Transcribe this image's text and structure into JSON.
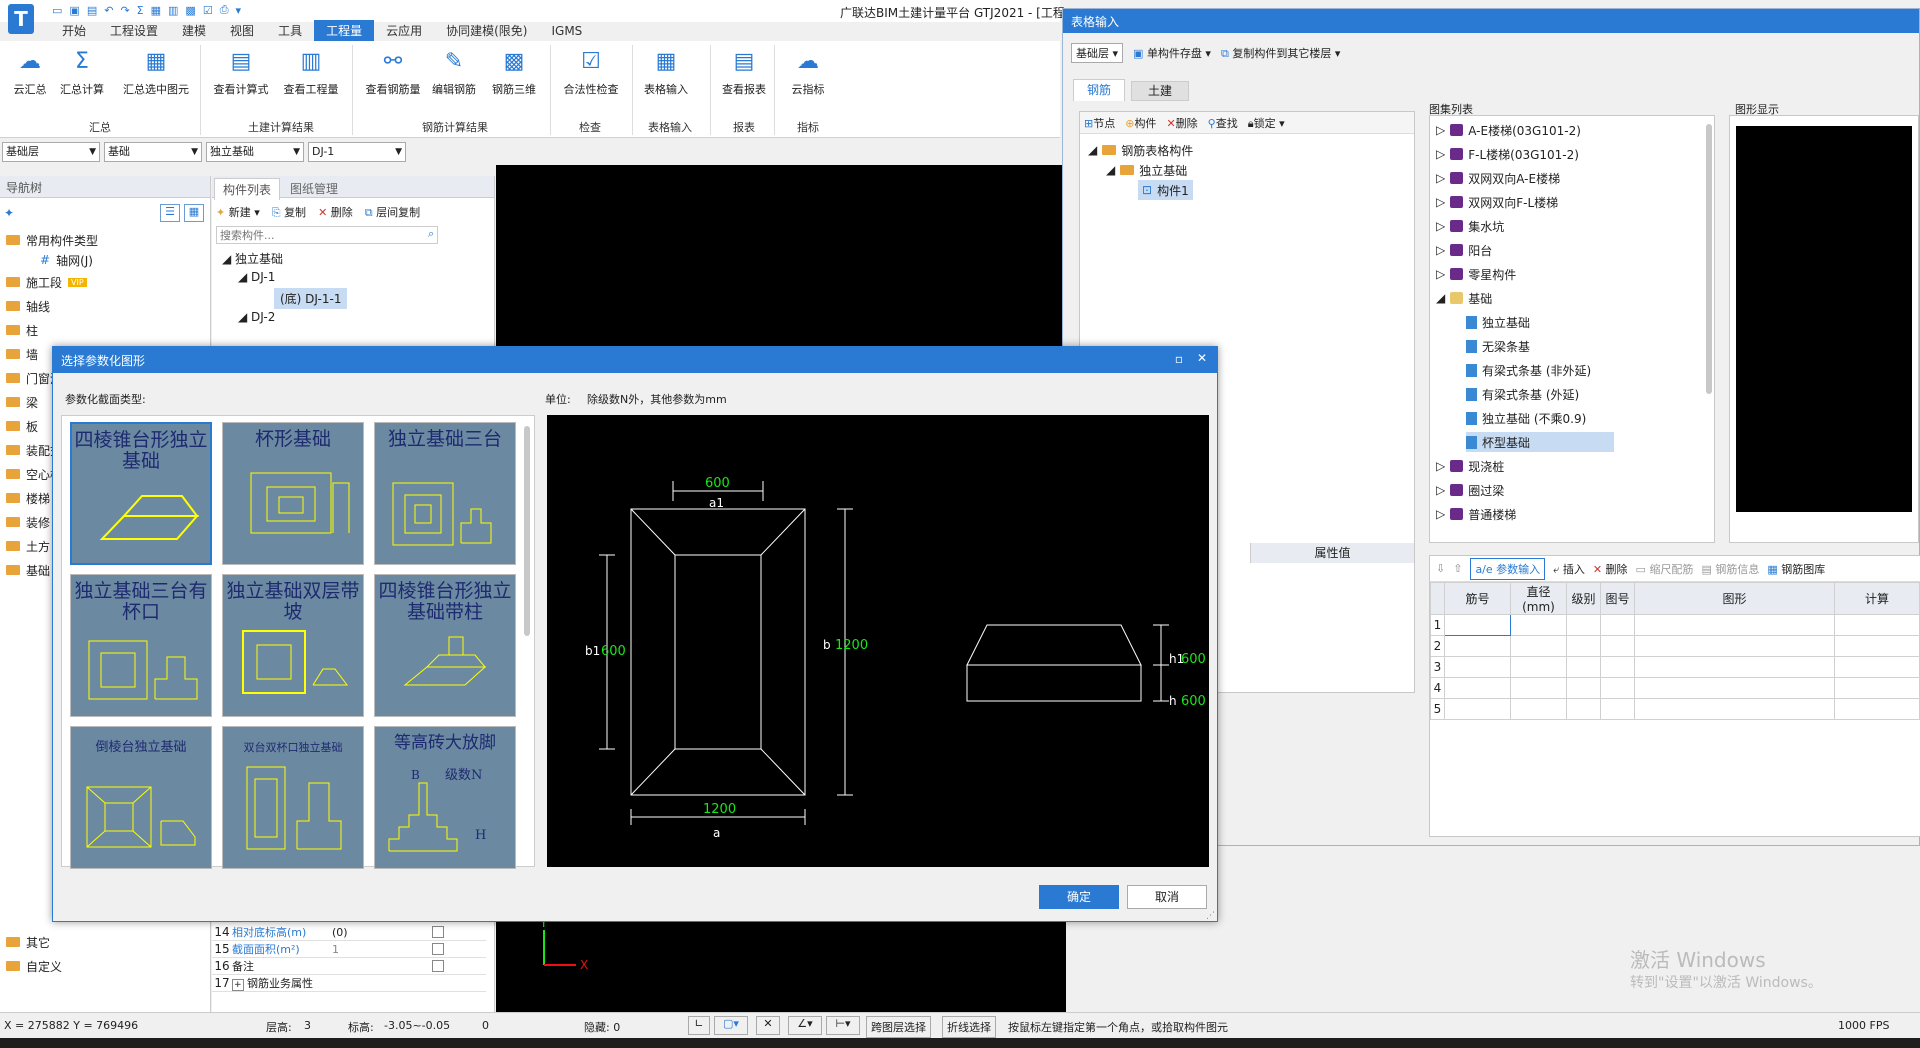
{
  "app": {
    "title": "广联达BIM土建计量平台 GTJ2021 - [工程1",
    "tabs": [
      "开始",
      "工程设置",
      "建模",
      "视图",
      "工具",
      "工程量",
      "云应用",
      "协同建模(限免)",
      "IGMS"
    ],
    "active_tab": "工程量"
  },
  "ribbon": {
    "buttons": [
      "云汇总",
      "汇总计算",
      "汇总选中图元",
      "查看计算式",
      "查看工程量",
      "查看钢筋量",
      "编辑钢筋",
      "钢筋三维",
      "合法性检查",
      "表格输入",
      "查看报表",
      "云指标"
    ],
    "groups": [
      "汇总",
      "土建计算结果",
      "钢筋计算结果",
      "检查",
      "表格输入",
      "报表",
      "指标"
    ]
  },
  "filters": [
    "基础层",
    "基础",
    "独立基础",
    "DJ-1"
  ],
  "navtree": {
    "header": "导航树",
    "items": [
      "常用构件类型",
      "轴网(J)",
      "施工段",
      "轴线",
      "柱",
      "墙",
      "门窗洞",
      "梁",
      "板",
      "装配式",
      "空心楼盖",
      "楼梯",
      "装修",
      "土方",
      "基础",
      "其它",
      "自定义"
    ],
    "vip": "VIP"
  },
  "complist": {
    "tabs": [
      "构件列表",
      "图纸管理"
    ],
    "toolbar": [
      "新建",
      "复制",
      "删除",
      "层间复制"
    ],
    "search_placeholder": "搜索构件...",
    "tree": [
      "独立基础",
      "DJ-1",
      "(底) DJ-1-1",
      "DJ-2"
    ],
    "props": [
      {
        "no": "14",
        "name": "相对底标高(m)",
        "val": "(0)"
      },
      {
        "no": "15",
        "name": "截面面积(m²)",
        "val": "1"
      },
      {
        "no": "16",
        "name": "备注",
        "val": ""
      },
      {
        "no": "17",
        "name": "钢筋业务属性",
        "val": ""
      }
    ]
  },
  "status": {
    "coords": "X = 275882 Y = 769496",
    "floor_label": "层高:",
    "floor": "3",
    "elev_label": "标高:",
    "elev": "-3.05~-0.05",
    "zero": "0",
    "hidden": "隐藏: 0",
    "btn1": "跨图层选择",
    "btn2": "折线选择",
    "hint": "按鼠标左键指定第一个角点，或拾取构件图元",
    "fps": "1000 FPS"
  },
  "watermark": {
    "line1": "激活 Windows",
    "line2": "转到\"设置\"以激活 Windows。"
  },
  "tblwin": {
    "title": "表格输入",
    "floor": "基础层",
    "tools": [
      "单构件存盘",
      "复制构件到其它楼层"
    ],
    "tabs": [
      "钢筋",
      "土建"
    ],
    "left_tools": [
      "节点",
      "构件",
      "删除",
      "查找",
      "锁定"
    ],
    "left_tree": [
      "钢筋表格构件",
      "独立基础",
      "构件1"
    ],
    "atlas_label": "图集列表",
    "graphic_label": "图形显示",
    "atlas": [
      "A-E楼梯(03G101-2)",
      "F-L楼梯(03G101-2)",
      "双网双向A-E楼梯",
      "双网双向F-L楼梯",
      "集水坑",
      "阳台",
      "零星构件",
      "基础",
      "独立基础",
      "无梁条基",
      "有梁式条基 (非外延)",
      "有梁式条基 (外延)",
      "独立基础 (不乘0.9)",
      "杯型基础",
      "现浇桩",
      "圈过梁",
      "普通楼梯"
    ],
    "prop_header": "属性值",
    "grid_tools": [
      "参数输入",
      "插入",
      "删除",
      "缩尺配筋",
      "钢筋信息",
      "钢筋图库"
    ],
    "grid_cols": [
      "筋号",
      "直径(mm)",
      "级别",
      "图号",
      "图形",
      "计算"
    ],
    "rows": [
      "1",
      "2",
      "3",
      "4",
      "5"
    ]
  },
  "dialog": {
    "title": "选择参数化图形",
    "type_label": "参数化截面类型:",
    "unit_label": "单位:",
    "unit_text": "除级数N外，其他参数为mm",
    "thumbs": [
      "四棱锥台形独立基础",
      "杯形基础",
      "独立基础三台",
      "独立基础三台有杯口",
      "独立基础双层带坡",
      "四棱锥台形独立基础带柱",
      "倒棱台独立基础",
      "双台双杯口独立基础",
      "等高砖大放脚"
    ],
    "ok": "确定",
    "cancel": "取消",
    "preview": {
      "a1_val": "600",
      "a1": "a1",
      "b1": "b1",
      "b1_val": "600",
      "b": "b",
      "b_val": "1200",
      "a_val": "1200",
      "a": "a",
      "h1": "h1",
      "h1_val": "600",
      "h": "h",
      "h_val": "600"
    }
  }
}
